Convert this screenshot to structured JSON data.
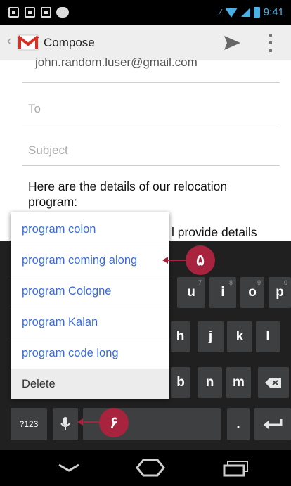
{
  "status_bar": {
    "time": "9:41",
    "icons": [
      "notification-icon",
      "notification-icon",
      "notification-icon",
      "chat-icon",
      "vibrate-icon",
      "wifi-icon",
      "signal-icon",
      "battery-icon"
    ]
  },
  "action_bar": {
    "title": "Compose",
    "icons": [
      "gmail-logo-icon",
      "send-icon",
      "overflow-menu-icon"
    ]
  },
  "compose": {
    "from": "john.random.luser@gmail.com",
    "to_placeholder": "To",
    "subject_placeholder": "Subject",
    "body_line1": "Here are the details of our relocation program:",
    "body_line2": "l provide details"
  },
  "suggestions": {
    "items": [
      "program colon",
      "program coming along",
      "program Cologne",
      "program Kalan",
      "program code long"
    ],
    "delete_label": "Delete"
  },
  "keyboard": {
    "row1": [
      {
        "label": "u",
        "hint": "7"
      },
      {
        "label": "i",
        "hint": "8"
      },
      {
        "label": "o",
        "hint": "9"
      },
      {
        "label": "p",
        "hint": "0"
      }
    ],
    "row2": [
      "h",
      "j",
      "k",
      "l"
    ],
    "row3": [
      "b",
      "n",
      "m"
    ],
    "symbols_label": "?123",
    "period_label": ".",
    "icons": [
      "backspace-icon",
      "microphone-icon",
      "enter-icon"
    ]
  },
  "callouts": {
    "first": "۵",
    "second": "۶"
  },
  "nav_bar": {
    "icons": [
      "back-icon",
      "home-icon",
      "recents-icon"
    ]
  },
  "colors": {
    "accent": "#4ab1e6",
    "suggestion_text": "#3a6bd6",
    "callout": "#a8233d",
    "keyboard_bg": "#202020",
    "key_bg": "#3d3f41"
  }
}
